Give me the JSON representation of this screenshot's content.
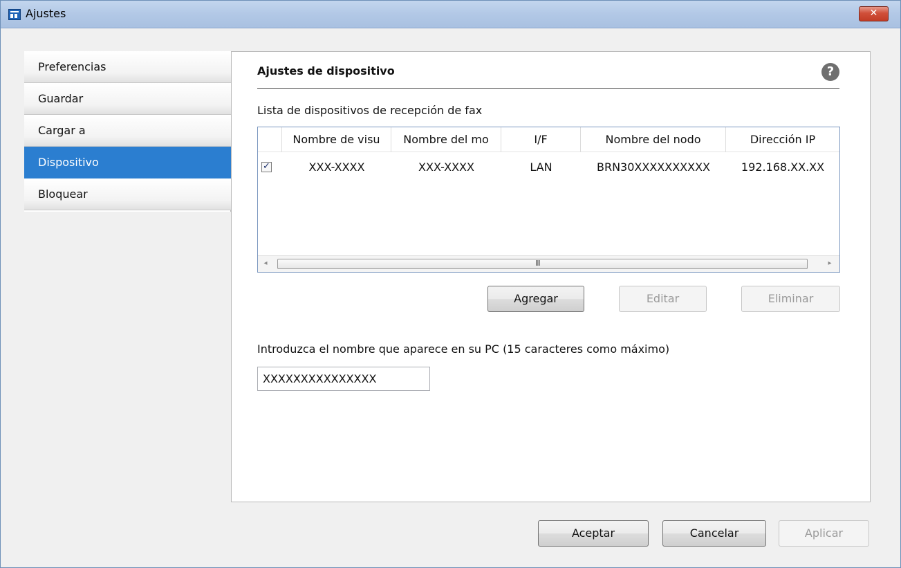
{
  "window": {
    "title": "Ajustes",
    "close_label": "✕"
  },
  "sidebar": {
    "items": [
      {
        "label": "Preferencias",
        "selected": false
      },
      {
        "label": "Guardar",
        "selected": false
      },
      {
        "label": "Cargar a",
        "selected": false
      },
      {
        "label": "Dispositivo",
        "selected": true
      },
      {
        "label": "Bloquear",
        "selected": false
      }
    ]
  },
  "panel": {
    "title": "Ajustes de dispositivo",
    "help_label": "?",
    "list_caption": "Lista de dispositivos de recepción de fax",
    "table": {
      "columns": [
        "Nombre de visu",
        "Nombre del mo",
        "I/F",
        "Nombre del nodo",
        "Dirección IP"
      ],
      "rows": [
        {
          "checked": true,
          "cells": [
            "XXX-XXXX",
            "XXX-XXXX",
            "LAN",
            "BRN30XXXXXXXXXX",
            "192.168.XX.XX"
          ]
        }
      ],
      "scroll_left": "◂",
      "scroll_right": "▸",
      "scroll_grip": "III"
    },
    "buttons": {
      "add": "Agregar",
      "edit": "Editar",
      "delete": "Eliminar"
    },
    "name_caption": "Introduzca el nombre que aparece en su PC (15 caracteres como máximo)",
    "name_value": "XXXXXXXXXXXXXXX"
  },
  "footer": {
    "ok": "Aceptar",
    "cancel": "Cancelar",
    "apply": "Aplicar"
  },
  "icons": {
    "app": "settings-app-icon",
    "help": "help-icon",
    "close": "close-icon",
    "check": "checkmark-icon"
  },
  "colors": {
    "selected_bg": "#2b7ed0",
    "titlebar": "#b2c8e6",
    "close_button": "#c23b25"
  }
}
